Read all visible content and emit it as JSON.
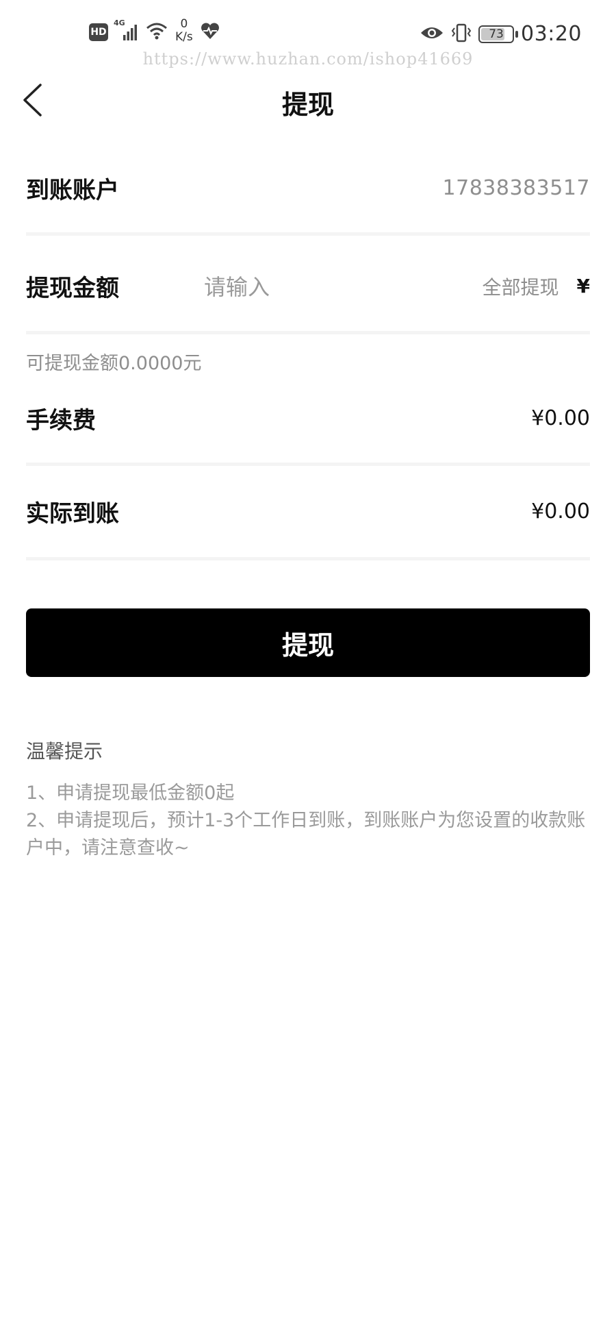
{
  "status_bar": {
    "hd": "HD",
    "network": "4G",
    "speed_value": "0",
    "speed_unit": "K/s",
    "battery": "73",
    "time": "03:20",
    "icons": [
      "hd-badge",
      "signal-icon",
      "wifi-icon",
      "heart-rate-icon",
      "eye-icon",
      "vibrate-icon",
      "battery-icon"
    ]
  },
  "watermark": "https://www.huzhan.com/ishop41669",
  "nav": {
    "back_icon": "chevron-left-icon",
    "title": "提现"
  },
  "account_row": {
    "label": "到账账户",
    "value": "17838383517"
  },
  "amount_row": {
    "label": "提现金额",
    "placeholder": "请输入",
    "value": "",
    "all_label": "全部提现",
    "currency": "¥"
  },
  "available_text": "可提现金额0.0000元",
  "fee_row": {
    "label": "手续费",
    "value": "¥0.00"
  },
  "actual_row": {
    "label": "实际到账",
    "value": "¥0.00"
  },
  "submit_label": "提现",
  "tips": {
    "title": "温馨提示",
    "items": [
      "1、申请提现最低金额0起",
      "2、申请提现后，预计1-3个工作日到账，到账账户为您设置的收款账户中，请注意查收~"
    ]
  },
  "colors": {
    "button_bg": "#000000",
    "button_text": "#ffffff",
    "muted_text": "#8e8e8e",
    "divider": "#f4f4f4"
  }
}
